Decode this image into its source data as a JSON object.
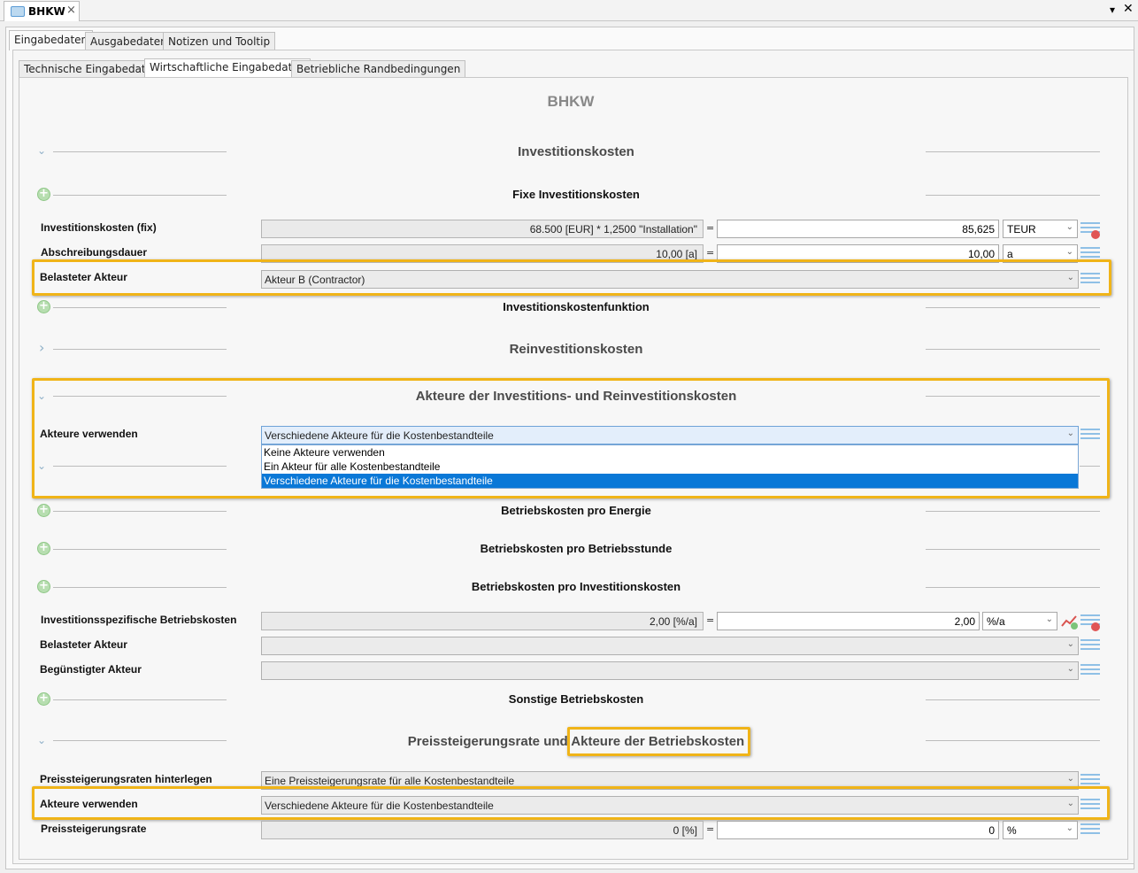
{
  "window": {
    "tab_title": "BHKW",
    "close_glyph": "×",
    "menu_glyph": "▾",
    "window_close_glyph": "✕"
  },
  "tabs_main": [
    "Eingabedaten",
    "Ausgabedaten",
    "Notizen und Tooltip"
  ],
  "tabs_sub": [
    "Technische Eingabedaten",
    "Wirtschaftliche Eingabedaten",
    "Betriebliche Randbedingungen"
  ],
  "page_title": "BHKW",
  "sections": {
    "investitionskosten": "Investitionskosten",
    "fixe": "Fixe Investitionskosten",
    "funktion": "Investitionskostenfunktion",
    "reinvest": "Reinvestitionskosten",
    "akteure_invest": "Akteure der Investitions- und Reinvestitionskosten",
    "bk_energie": "Betriebskosten pro Energie",
    "bk_stunde": "Betriebskosten pro Betriebsstunde",
    "bk_invest": "Betriebskosten pro Investitionskosten",
    "sonstige": "Sonstige Betriebskosten",
    "preis_a": "Preissteigerungsrate und ",
    "preis_b": "Akteure der Betriebskosten"
  },
  "rows": {
    "inv_fix": {
      "label": "Investitionskosten (fix)",
      "formula": "68.500 [EUR] * 1,2500 \"Installation\"",
      "eq": "=",
      "value": "85,625",
      "unit": "TEUR"
    },
    "abschreibung": {
      "label": "Abschreibungsdauer",
      "formula": "10,00 [a]",
      "eq": "=",
      "value": "10,00",
      "unit": "a"
    },
    "belasteter1": {
      "label": "Belasteter Akteur",
      "value": "Akteur B (Contractor)"
    },
    "akteure_verwenden1": {
      "label": "Akteure verwenden",
      "value": "Verschiedene Akteure für die Kostenbestandteile"
    },
    "inv_spez": {
      "label": "Investitionsspezifische Betriebskosten",
      "formula": "2,00 [%/a]",
      "eq": "=",
      "value": "2,00",
      "unit": "%/a"
    },
    "belasteter2": {
      "label": "Belasteter Akteur",
      "value": ""
    },
    "beguenstigter": {
      "label": "Begünstigter Akteur",
      "value": ""
    },
    "preis_hinterlegen": {
      "label": "Preissteigerungsraten hinterlegen",
      "value": "Eine Preissteigerungsrate für alle Kostenbestandteile"
    },
    "akteure_verwenden2": {
      "label": "Akteure verwenden",
      "value": "Verschiedene Akteure für die Kostenbestandteile"
    },
    "preisrate": {
      "label": "Preissteigerungsrate",
      "formula": "0 [%]",
      "eq": "=",
      "value": "0",
      "unit": "%"
    }
  },
  "dropdown_options": [
    "Keine Akteure verwenden",
    "Ein Akteur für alle Kostenbestandteile",
    "Verschiedene Akteure für die Kostenbestandteile"
  ],
  "glyphs": {
    "chevron_down": "⌄",
    "chevron_right": "›",
    "plus": "+",
    "select_arrow": "⌄"
  },
  "colors": {
    "highlight": "#f0b418",
    "selection": "#0a78d7",
    "plus_green": "#b7deb0"
  }
}
